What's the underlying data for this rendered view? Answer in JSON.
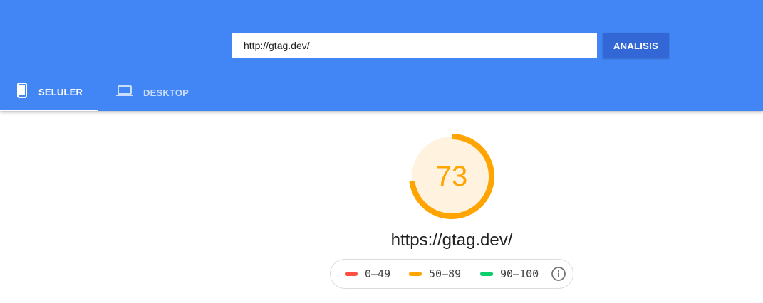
{
  "search": {
    "url_value": "http://gtag.dev/",
    "analyze_label": "ANALISIS"
  },
  "tabs": [
    {
      "label": "SELULER",
      "icon": "smartphone-icon",
      "active": true
    },
    {
      "label": "DESKTOP",
      "icon": "laptop-icon",
      "active": false
    }
  ],
  "result": {
    "score": "73",
    "score_fraction": 0.73,
    "url": "https://gtag.dev/"
  },
  "legend": [
    {
      "range": "0–49",
      "color": "#ff4e42"
    },
    {
      "range": "50–89",
      "color": "#ffa400"
    },
    {
      "range": "90–100",
      "color": "#0cce6b"
    }
  ],
  "colors": {
    "header": "#4285f4",
    "button": "#3367d6",
    "score": "#ffa400",
    "score_bg": "#fff3e0"
  }
}
